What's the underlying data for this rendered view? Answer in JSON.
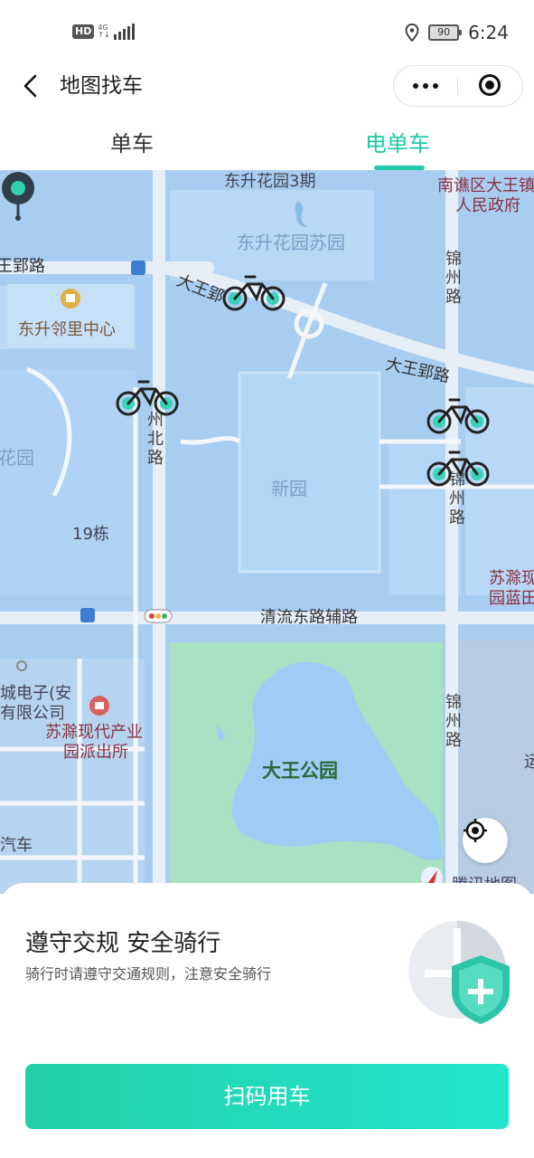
{
  "status_bar": {
    "hd": "HD",
    "network": "4G",
    "battery": "90",
    "time": "6:24"
  },
  "header": {
    "title": "地图找车"
  },
  "tabs": [
    {
      "label": "单车"
    },
    {
      "label": "电单车"
    }
  ],
  "map": {
    "labels": {
      "dongsheng_phase3": "东升花园3期",
      "dongsheng_suyuan": "东升花园苏园",
      "gov_line1": "南谯区大王镇",
      "gov_line2": "人民政府",
      "wangying_road_left": "王郢路",
      "dawangying_road_1": "大王郢",
      "dawangying_road_2": "大王郢路",
      "neighborhood_center": "东升邻里中心",
      "garden_left": "花园",
      "building_19": "19栋",
      "park_small": "新园",
      "qingliu_road": "清流东路辅路",
      "suchu_modern": "苏滁现代",
      "suchu_modern_2": "园蓝田",
      "company_line1": "城电子(安",
      "company_line2": "有限公司",
      "police_line1": "苏滁现代产业",
      "police_line2": "园派出所",
      "dawang_park": "大王公园",
      "auto_label": "汽车",
      "tencent_map": "腾讯地图",
      "edge_char": "运",
      "jinzhou_north": "州北路",
      "jinzhou_1": "锦州路",
      "jinzhou_2": "锦州路",
      "jinzhou_3": "锦州路"
    }
  },
  "sheet": {
    "title": "遵守交规 安全骑行",
    "subtitle": "骑行时请遵守交通规则，注意安全骑行",
    "scan_button": "扫码用车"
  },
  "colors": {
    "accent": "#1fc9a9",
    "map_water": "#a9cdf0",
    "park_green": "#a8e2c2",
    "bike_green": "#3ad2b8"
  }
}
